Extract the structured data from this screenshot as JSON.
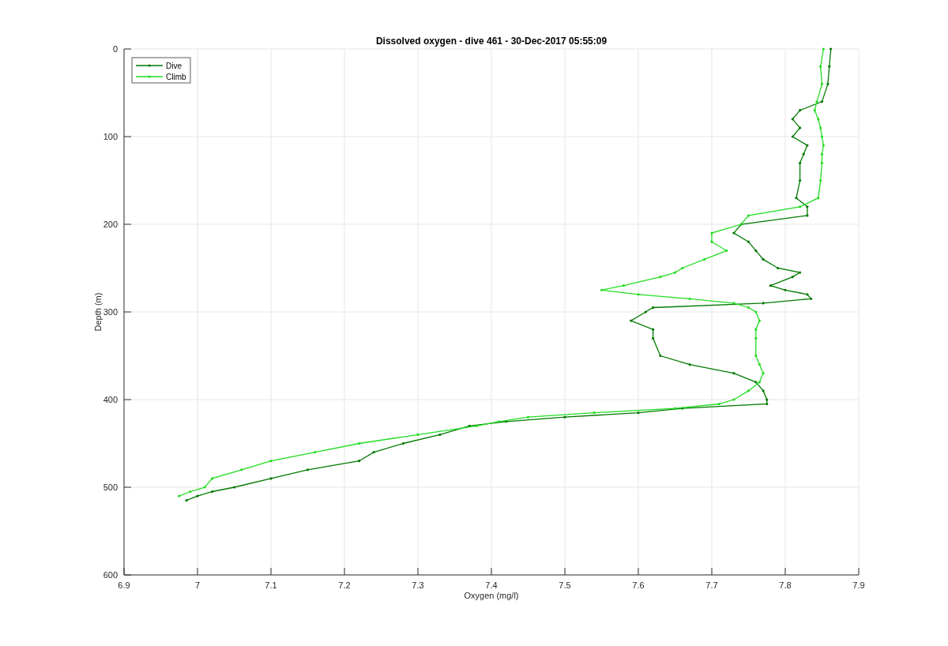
{
  "figure": {
    "chart_data": {
      "type": "line",
      "orientation": "horizontal",
      "title": "Dissolved oxygen - dive 461 - 30-Dec-2017 05:55:09",
      "xlabel": "Oxygen (mg/l)",
      "ylabel": "Depth (m)",
      "x": [
        0,
        20,
        40,
        60,
        70,
        80,
        90,
        100,
        110,
        120,
        130,
        150,
        170,
        180,
        190,
        200,
        210,
        220,
        230,
        240,
        250,
        255,
        260,
        270,
        275,
        280,
        285,
        290,
        295,
        300,
        310,
        320,
        330,
        350,
        360,
        370,
        380,
        390,
        400,
        405,
        410,
        415,
        420,
        425,
        430,
        440,
        450,
        460,
        470,
        480,
        490,
        500,
        505,
        510,
        515
      ],
      "series": [
        {
          "name": "Dive",
          "color": "#007a00",
          "values": [
            7.862,
            7.86,
            7.858,
            7.85,
            7.82,
            7.81,
            7.82,
            7.81,
            7.83,
            7.825,
            7.82,
            7.82,
            7.815,
            7.83,
            7.83,
            7.74,
            7.73,
            7.75,
            7.76,
            7.77,
            7.79,
            7.82,
            7.81,
            7.78,
            7.8,
            7.83,
            7.835,
            7.77,
            7.62,
            7.61,
            7.59,
            7.62,
            7.62,
            7.63,
            7.67,
            7.73,
            7.76,
            7.77,
            7.775,
            7.775,
            7.66,
            7.6,
            7.5,
            7.42,
            7.37,
            7.33,
            7.28,
            7.24,
            7.22,
            7.15,
            7.1,
            7.05,
            7.02,
            7.0,
            6.985
          ]
        },
        {
          "name": "Climb",
          "color": "#22dd22",
          "values": [
            7.852,
            7.848,
            7.85,
            7.843,
            7.84,
            7.845,
            7.848,
            7.85,
            7.852,
            7.85,
            7.85,
            7.848,
            7.845,
            7.82,
            7.75,
            7.74,
            7.7,
            7.7,
            7.72,
            7.69,
            7.66,
            7.65,
            7.63,
            7.58,
            7.55,
            7.6,
            7.67,
            7.73,
            7.75,
            7.76,
            7.765,
            7.76,
            7.76,
            7.76,
            7.765,
            7.77,
            7.765,
            7.75,
            7.73,
            7.71,
            7.65,
            7.54,
            7.45,
            7.41,
            7.38,
            7.3,
            7.22,
            7.16,
            7.1,
            7.06,
            7.02,
            7.01,
            6.99,
            6.975,
            null
          ]
        }
      ],
      "xlim": [
        6.9,
        7.9
      ],
      "ylim": [
        600,
        0
      ],
      "grid": true,
      "legend": true,
      "xticks": [
        6.9,
        7,
        7.1,
        7.2,
        7.3,
        7.4,
        7.5,
        7.6,
        7.7,
        7.8,
        7.9
      ],
      "yticks": [
        0,
        100,
        200,
        300,
        400,
        500,
        600
      ]
    }
  }
}
